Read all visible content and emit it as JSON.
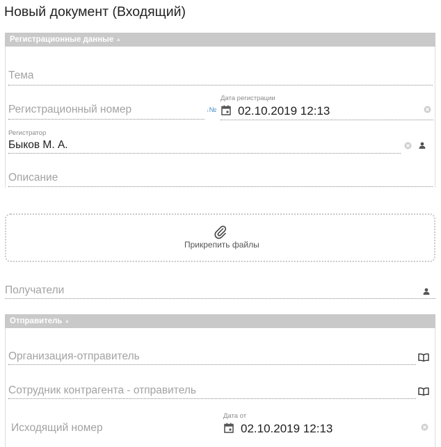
{
  "page": {
    "title": "Новый документ (Входящий)"
  },
  "registration_panel": {
    "header": "Регистрационные данные",
    "caret": "▲",
    "subject_placeholder": "Тема",
    "reg_number_placeholder": "Регистрационный номер",
    "numbering_icon": "№",
    "reg_date_label": "Дата регистрации",
    "reg_date_value": "02.10.2019 12:13",
    "registrar_label": "Регистратор",
    "registrar_value": "Быков М. А.",
    "description_placeholder": "Описание"
  },
  "attachments": {
    "label": "Прикрепить файлы",
    "icon": "paperclip-icon"
  },
  "recipients": {
    "placeholder": "Получатели"
  },
  "sender_panel": {
    "header": "Отправитель",
    "caret": "▲",
    "organization_placeholder": "Организация-отправитель",
    "employee_placeholder": "Сотрудник контрагента - отправитель",
    "outgoing_number_placeholder": "Исходящий номер",
    "date_from_label": "Дата от",
    "date_from_value": "02.10.2019 12:13"
  },
  "colors": {
    "panel_header": "#c9c9c9",
    "icon": "#555555",
    "placeholder": "#a2a2a2"
  }
}
